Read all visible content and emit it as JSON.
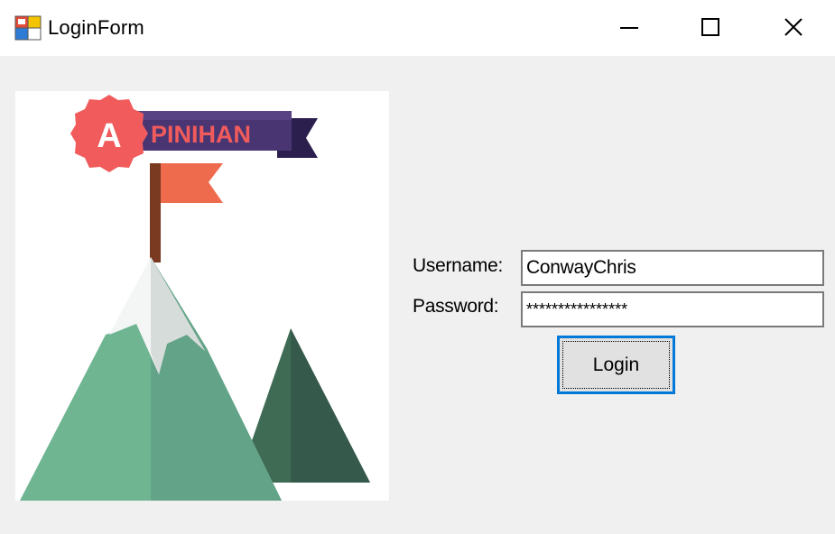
{
  "window": {
    "title": "LoginForm",
    "controls": {
      "minimize": "minimize",
      "maximize": "maximize",
      "close": "close"
    }
  },
  "logo": {
    "badge_letter": "A",
    "brand_text": "PINIHAN"
  },
  "form": {
    "username_label": "Username:",
    "password_label": "Password:",
    "username_value": "ConwayChris",
    "password_value": "****************",
    "login_label": "Login"
  },
  "colors": {
    "accent": "#0078d7",
    "badge": "#f15b5b",
    "banner": "#4a3573",
    "flag": "#ee6b4d",
    "mountain_light": "#6fb592",
    "mountain_dark": "#3f6b55"
  }
}
